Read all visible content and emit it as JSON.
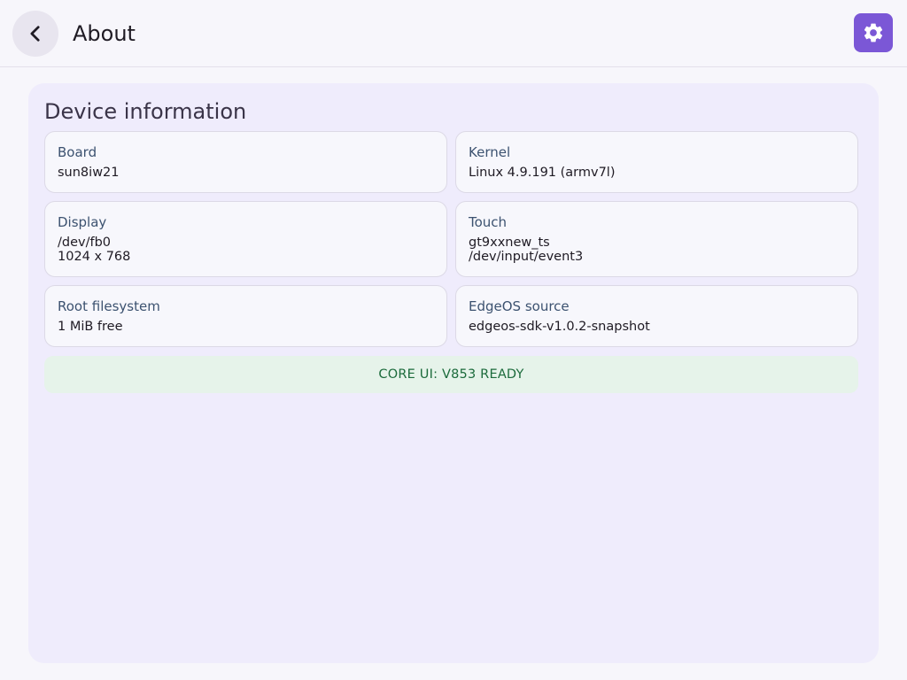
{
  "header": {
    "title": "About",
    "back_icon": "chevron-left-icon",
    "settings_icon": "gear-icon",
    "accent_color": "#7b57d6"
  },
  "device_info": {
    "title": "Device information",
    "cards": [
      {
        "label": "Board",
        "lines": [
          "sun8iw21"
        ]
      },
      {
        "label": "Kernel",
        "lines": [
          "Linux 4.9.191 (armv7l)"
        ]
      },
      {
        "label": "Display",
        "lines": [
          "/dev/fb0",
          "1024 x 768"
        ]
      },
      {
        "label": "Touch",
        "lines": [
          "gt9xxnew_ts",
          "/dev/input/event3"
        ]
      },
      {
        "label": "Root filesystem",
        "lines": [
          "1 MiB free"
        ]
      },
      {
        "label": "EdgeOS source",
        "lines": [
          "edgeos-sdk-v1.0.2-snapshot"
        ]
      }
    ],
    "status": "CORE UI: V853 READY",
    "status_color": "#1c6b3c"
  }
}
